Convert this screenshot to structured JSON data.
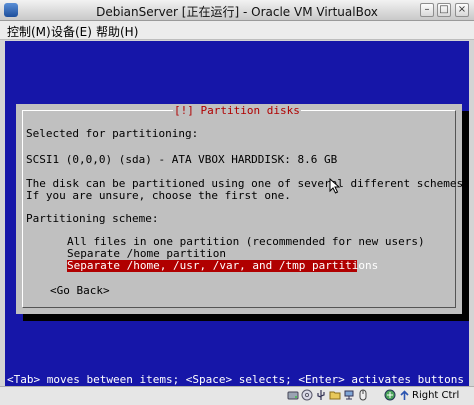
{
  "window": {
    "title": "DebianServer [正在运行] - Oracle VM VirtualBox",
    "minimize_glyph": "–",
    "maximize_glyph": "□",
    "close_glyph": "×"
  },
  "menubar": {
    "items": [
      "控制(M)",
      "设备(E)",
      "帮助(H)"
    ]
  },
  "installer": {
    "dialog_title": "[!] Partition disks",
    "selected_label": "Selected for partitioning:",
    "disk": "SCSI1 (0,0,0) (sda) - ATA VBOX HARDDISK: 8.6 GB",
    "description_line1": "The disk can be partitioned using one of several different schemes.",
    "description_line2": "If you are unsure, choose the first one.",
    "scheme_label": "Partitioning scheme:",
    "options": [
      "All files in one partition (recommended for new users)",
      "Separate /home partition",
      "Separate /home, /usr, /var, and /tmp partitions"
    ],
    "selected_option_index": 2,
    "go_back": "<Go Back>",
    "help_line": "<Tab> moves between items; <Space> selects; <Enter> activates buttons"
  },
  "statusbar": {
    "icons": [
      "hard-disk-icon",
      "optical-drive-icon",
      "usb-icon",
      "shared-folder-icon",
      "network-icon",
      "mouse-integration-icon",
      "capture-icon"
    ],
    "host_key": "Right Ctrl"
  },
  "colors": {
    "vm_background": "#1616a8",
    "dialog_background": "#c0c0c0",
    "accent_red": "#b00000"
  }
}
